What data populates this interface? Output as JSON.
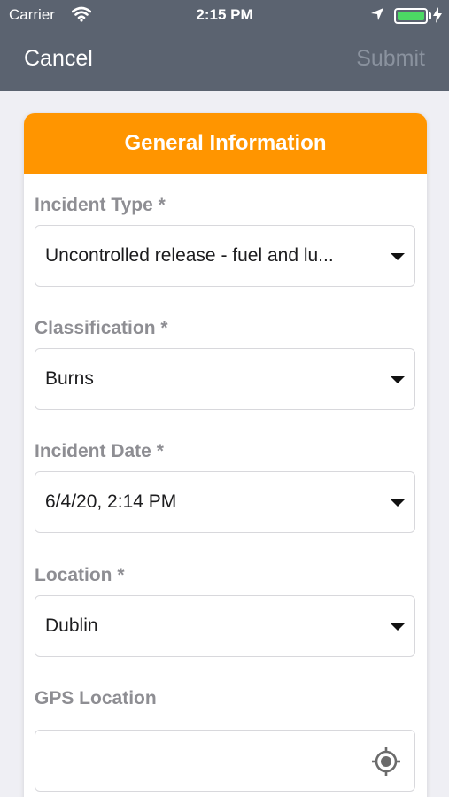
{
  "status_bar": {
    "carrier": "Carrier",
    "time": "2:15 PM",
    "icons": [
      "wifi-icon",
      "location-arrow-icon",
      "battery-icon",
      "charging-bolt-icon"
    ],
    "battery_color": "#4cd964"
  },
  "nav": {
    "cancel_label": "Cancel",
    "submit_label": "Submit"
  },
  "section": {
    "title": "General Information",
    "header_color": "#ff9500"
  },
  "fields": [
    {
      "label": "Incident Type *",
      "value": "Uncontrolled release - fuel and lu..."
    },
    {
      "label": "Classification *",
      "value": "Burns"
    },
    {
      "label": "Incident Date *",
      "value": "6/4/20, 2:14 PM"
    },
    {
      "label": "Location *",
      "value": "Dublin"
    }
  ],
  "gps": {
    "label": "GPS Location",
    "value": "",
    "icon": "gps-target-icon"
  },
  "colors": {
    "nav_background": "#5b6370",
    "page_background": "#efeff4",
    "label_color": "#8e8e93",
    "submit_disabled": "#8a929e"
  }
}
